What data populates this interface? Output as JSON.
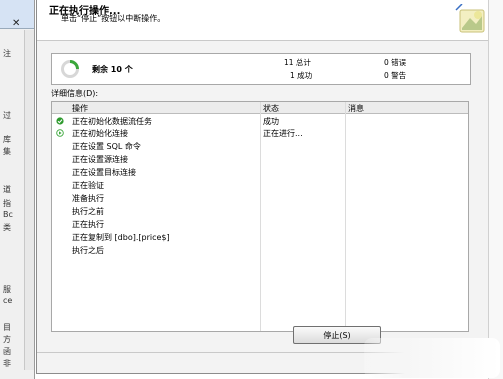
{
  "background": {
    "side_chars": [
      "注",
      "过",
      "库",
      "集",
      "道",
      "指",
      "Bc",
      "类",
      "服",
      "ce",
      "目",
      "方",
      "函",
      "非"
    ]
  },
  "header": {
    "title": "正在执行操作...",
    "subtitle": "单击“停止”按钮以中断操作。"
  },
  "summary": {
    "remaining": "剩余 10 个",
    "total": "11 总计",
    "success": "1 成功",
    "errors": "0 错误",
    "warnings": "0 警告"
  },
  "details_label": "详细信息(D):",
  "table": {
    "columns": [
      "操作",
      "状态",
      "消息"
    ],
    "rows": [
      {
        "action": "正在初始化数据流任务",
        "status": "成功",
        "message": "",
        "icon": "success-icon"
      },
      {
        "action": "正在初始化连接",
        "status": "正在进行...",
        "message": "",
        "icon": "in-progress-icon"
      },
      {
        "action": "正在设置 SQL 命令",
        "status": "",
        "message": "",
        "icon": ""
      },
      {
        "action": "正在设置源连接",
        "status": "",
        "message": "",
        "icon": ""
      },
      {
        "action": "正在设置目标连接",
        "status": "",
        "message": "",
        "icon": ""
      },
      {
        "action": "正在验证",
        "status": "",
        "message": "",
        "icon": ""
      },
      {
        "action": "准备执行",
        "status": "",
        "message": "",
        "icon": ""
      },
      {
        "action": "执行之前",
        "status": "",
        "message": "",
        "icon": ""
      },
      {
        "action": "正在执行",
        "status": "",
        "message": "",
        "icon": ""
      },
      {
        "action": "正在复制到 [dbo].[price$]",
        "status": "",
        "message": "",
        "icon": ""
      },
      {
        "action": "执行之后",
        "status": "",
        "message": "",
        "icon": ""
      }
    ]
  },
  "buttons": {
    "stop": "停止(S)"
  },
  "colors": {
    "success": "#2e9a2e",
    "progress": "#3aa63a"
  }
}
